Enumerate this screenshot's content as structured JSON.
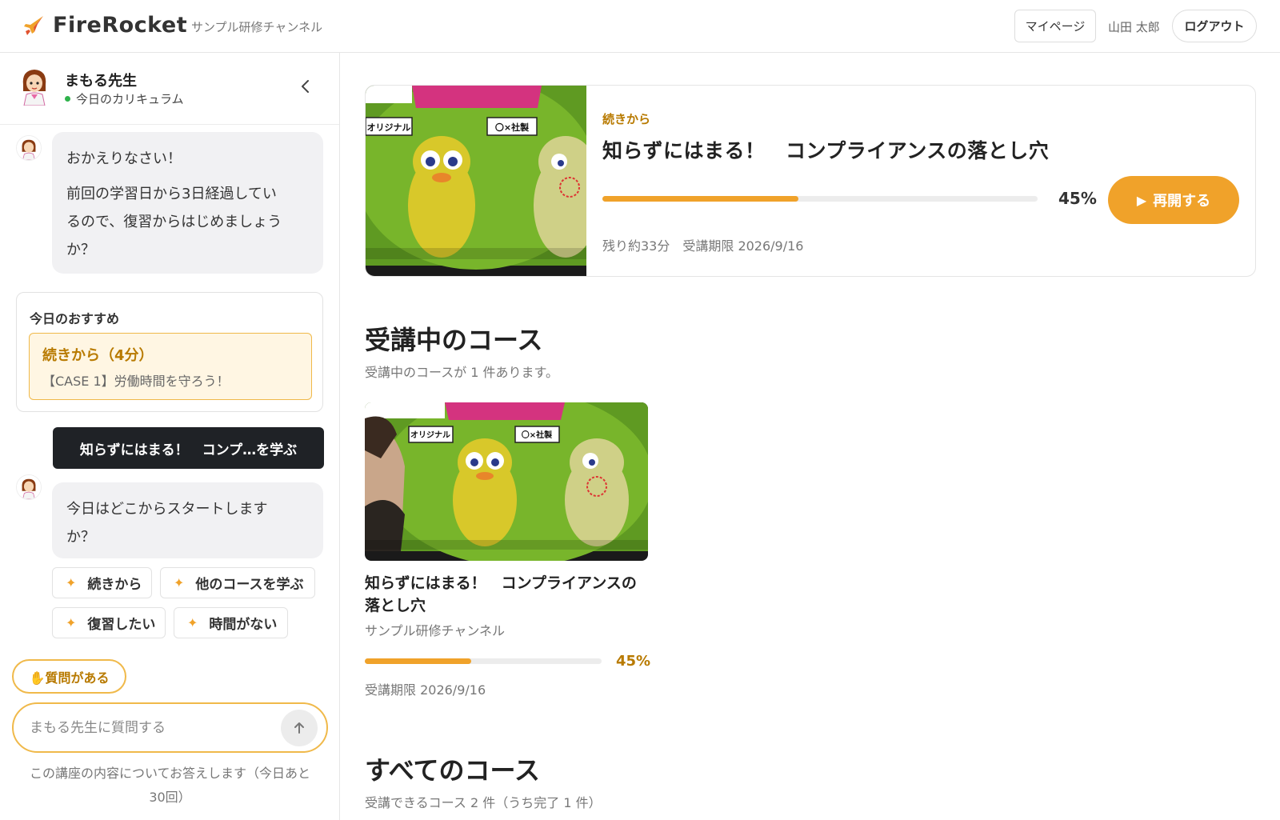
{
  "header": {
    "logo_text": "FireRocket",
    "channel_name": "サンプル研修チャンネル",
    "mypage_label": "マイページ",
    "username": "山田 太郎",
    "logout_label": "ログアウト"
  },
  "sidebar": {
    "teacher_name": "まもる先生",
    "teacher_status": "今日のカリキュラム",
    "messages": [
      {
        "paragraph1": "おかえりなさい！",
        "paragraph2_line1": "前回の学習日から3日経過してい",
        "paragraph2_line2": "るので、復習からはじめましょう",
        "paragraph2_line3": "か？"
      },
      {
        "line1": "今日はどこからスタートします",
        "line2": "か？"
      }
    ],
    "recommend": {
      "title": "今日のおすすめ",
      "main": "続きから（4分）",
      "sub": "【CASE 1】労働時間を守ろう！"
    },
    "user_reply": "知らずにはまる！　コンプ…を学ぶ",
    "chips": [
      "続きから",
      "他のコースを学ぶ",
      "復習したい",
      "時間がない"
    ],
    "question_button": "✋質問がある",
    "input_placeholder": "まもる先生に質問する",
    "note_line1": "この講座の内容についてお答えします（今日あと",
    "note_line2": "30回）"
  },
  "resume": {
    "label": "続きから",
    "title": "知らずにはまる！　コンプライアンスの落とし穴",
    "progress": 45,
    "progress_label": "45%",
    "button_label": "再開する",
    "meta": "残り約33分　受講期限 2026/9/16",
    "thumb_caption_left": "オリジナル",
    "thumb_caption_right": "〇×社製"
  },
  "in_progress": {
    "title": "受講中のコース",
    "subtitle": "受講中のコースが 1 件あります。",
    "courses": [
      {
        "title": "知らずにはまる！　コンプライアンスの落とし穴",
        "channel": "サンプル研修チャンネル",
        "progress": 45,
        "progress_label": "45%",
        "deadline": "受講期限 2026/9/16",
        "thumb_caption_left": "オリジナル",
        "thumb_caption_right": "〇×社製"
      }
    ]
  },
  "all_courses": {
    "title": "すべてのコース",
    "subtitle": "受講できるコース 2 件（うち完了 1 件）"
  },
  "colors": {
    "accent": "#f0a22a",
    "accent_dark": "#b87a00",
    "recommend_bg": "#fff6e3",
    "dark_button": "#1f2226",
    "online_dot": "#2fb24c"
  }
}
